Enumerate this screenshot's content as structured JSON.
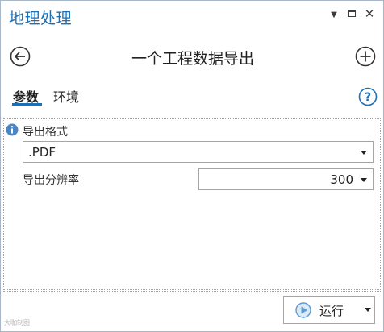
{
  "window": {
    "title": "地理处理",
    "menu_glyph": "▼",
    "close_glyph": "✕"
  },
  "tool": {
    "title": "一个工程数据导出"
  },
  "tabs": [
    {
      "label": "参数",
      "active": true
    },
    {
      "label": "环境",
      "active": false
    }
  ],
  "params": {
    "export_format": {
      "label": "导出格式",
      "value": ".PDF"
    },
    "resolution": {
      "label": "导出分辨率",
      "value": "300"
    }
  },
  "footer": {
    "run_label": "运行"
  },
  "watermark": "大咖制图",
  "colors": {
    "accent": "#1d6fb5",
    "run_icon": "#5b9bd5",
    "info_icon": "#4a86c5"
  },
  "icons": [
    "back-icon",
    "add-icon",
    "help-icon",
    "info-icon",
    "run-icon",
    "menu-chevron-icon",
    "maximize-icon",
    "close-icon"
  ]
}
